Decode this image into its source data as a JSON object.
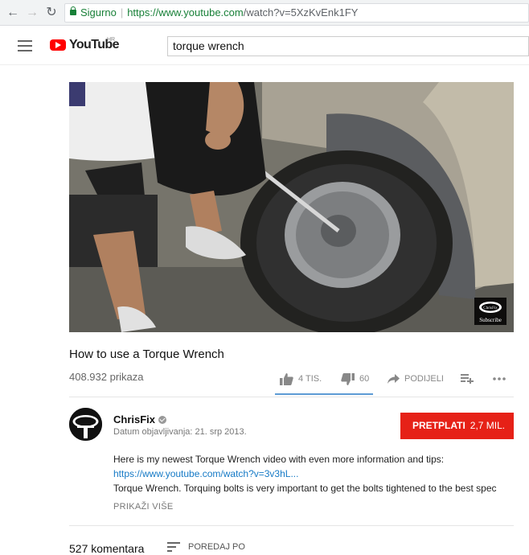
{
  "browser": {
    "secure_label": "Sigurno",
    "url_host": "https://www.youtube.com",
    "url_path": "/watch?v=5XzKvEnk1FY",
    "back_icon": "←",
    "forward_icon": "→",
    "reload_icon": "↻"
  },
  "header": {
    "logo_text": "YouTube",
    "logo_country": "HR",
    "search_value": "torque wrench"
  },
  "video": {
    "title": "How to use a Torque Wrench",
    "views": "408.932 prikaza",
    "watermark_label": "Subscribe",
    "watermark_logo_text": "ChrisFix"
  },
  "actions": {
    "likes": "4 TIS.",
    "dislikes": "60",
    "share": "PODIJELI"
  },
  "channel": {
    "name": "ChrisFix",
    "published": "Datum objavljivanja: 21. srp 2013.",
    "subscribe_label": "PRETPLATI",
    "subscriber_count": "2,7 MIL."
  },
  "description": {
    "line1": "Here is my newest Torque Wrench video with even more information and tips:",
    "link": "https://www.youtube.com/watch?v=3v3hL...",
    "line3": "Torque Wrench. Torquing bolts is very important to get the bolts tightened to the best spec",
    "show_more": "PRIKAŽI VIŠE"
  },
  "comments": {
    "count": "527 komentara",
    "sort_label": "POREDAJ PO"
  },
  "colors": {
    "brand_red": "#ff0000",
    "subscribe_red": "#e62117",
    "link_blue": "#167ac6",
    "secure_green": "#188038"
  }
}
